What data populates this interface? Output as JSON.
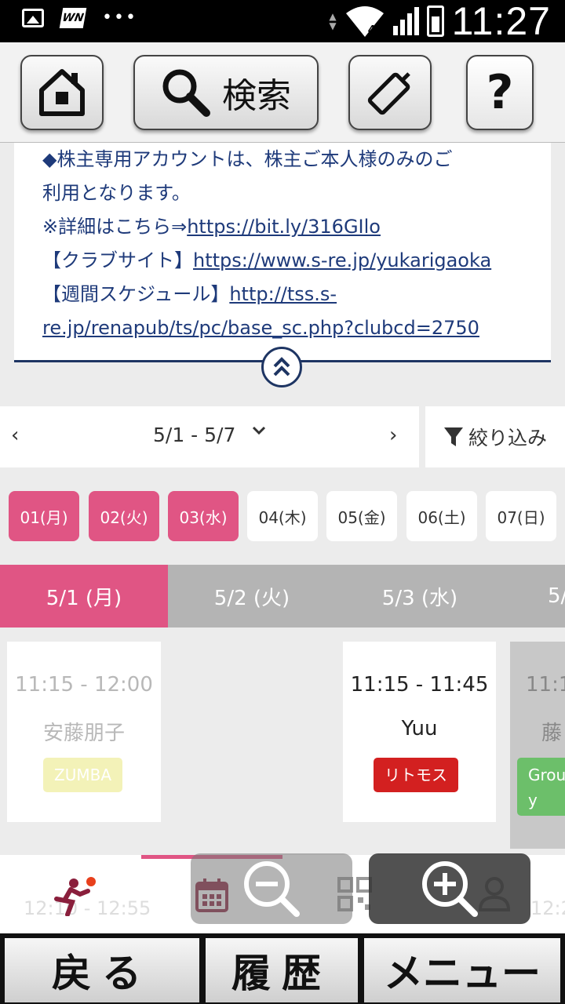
{
  "status_bar": {
    "time": "11:27",
    "signal_badge": "4",
    "left_icons": [
      "image-icon",
      "wn-app-icon",
      "more-dots-icon"
    ]
  },
  "toolbar": {
    "home_icon": "home-icon",
    "search_label": "検索",
    "tag_icon": "tag-icon",
    "help_label": "?"
  },
  "info": {
    "line1": "◆株主専用アカウントは、株主ご本人様のみのご",
    "line2": "利用となります。",
    "line3_prefix": "※詳細はこちら⇒",
    "line3_link": "https://bit.ly/316GIlo",
    "line4_prefix": "【クラブサイト】",
    "line4_link": "https://www.s-re.jp/yukarigaoka",
    "line5_prefix": "【週間スケジュール】",
    "line5_link": "http://tss.s-",
    "line6_link": "re.jp/renapub/ts/pc/base_sc.php?clubcd=2750"
  },
  "range": {
    "label": "5/1 - 5/7",
    "filter_label": "絞り込み"
  },
  "chips": [
    "01(月)",
    "02(火)",
    "03(水)",
    "04(木)",
    "05(金)",
    "06(土)",
    "07(日)"
  ],
  "day_tabs": [
    "5/1 (月)",
    "5/2 (火)",
    "5/3 (水)",
    "5/"
  ],
  "cards": {
    "c1": {
      "time": "11:15 - 12:00",
      "instructor": "安藤朋子",
      "tag": "ZUMBA"
    },
    "c2": {
      "time": "11:15 - 11:45",
      "instructor": "Yuu",
      "tag": "リトモス"
    },
    "c3": {
      "time": "11:1",
      "instructor": "藤",
      "tag": "Grou y"
    }
  },
  "app_nav": {
    "ghost_time": "12:10 - 12:55",
    "ghost_time_right": "12:2"
  },
  "hard_buttons": {
    "back": "戻る",
    "history": "履歴",
    "menu": "メニュー"
  },
  "colors": {
    "accent_pink": "#e05584",
    "navy": "#1e3563",
    "tag_zumba": "#f3f2b8",
    "tag_ritmos": "#d32020",
    "tag_group": "#6cbf6a"
  }
}
